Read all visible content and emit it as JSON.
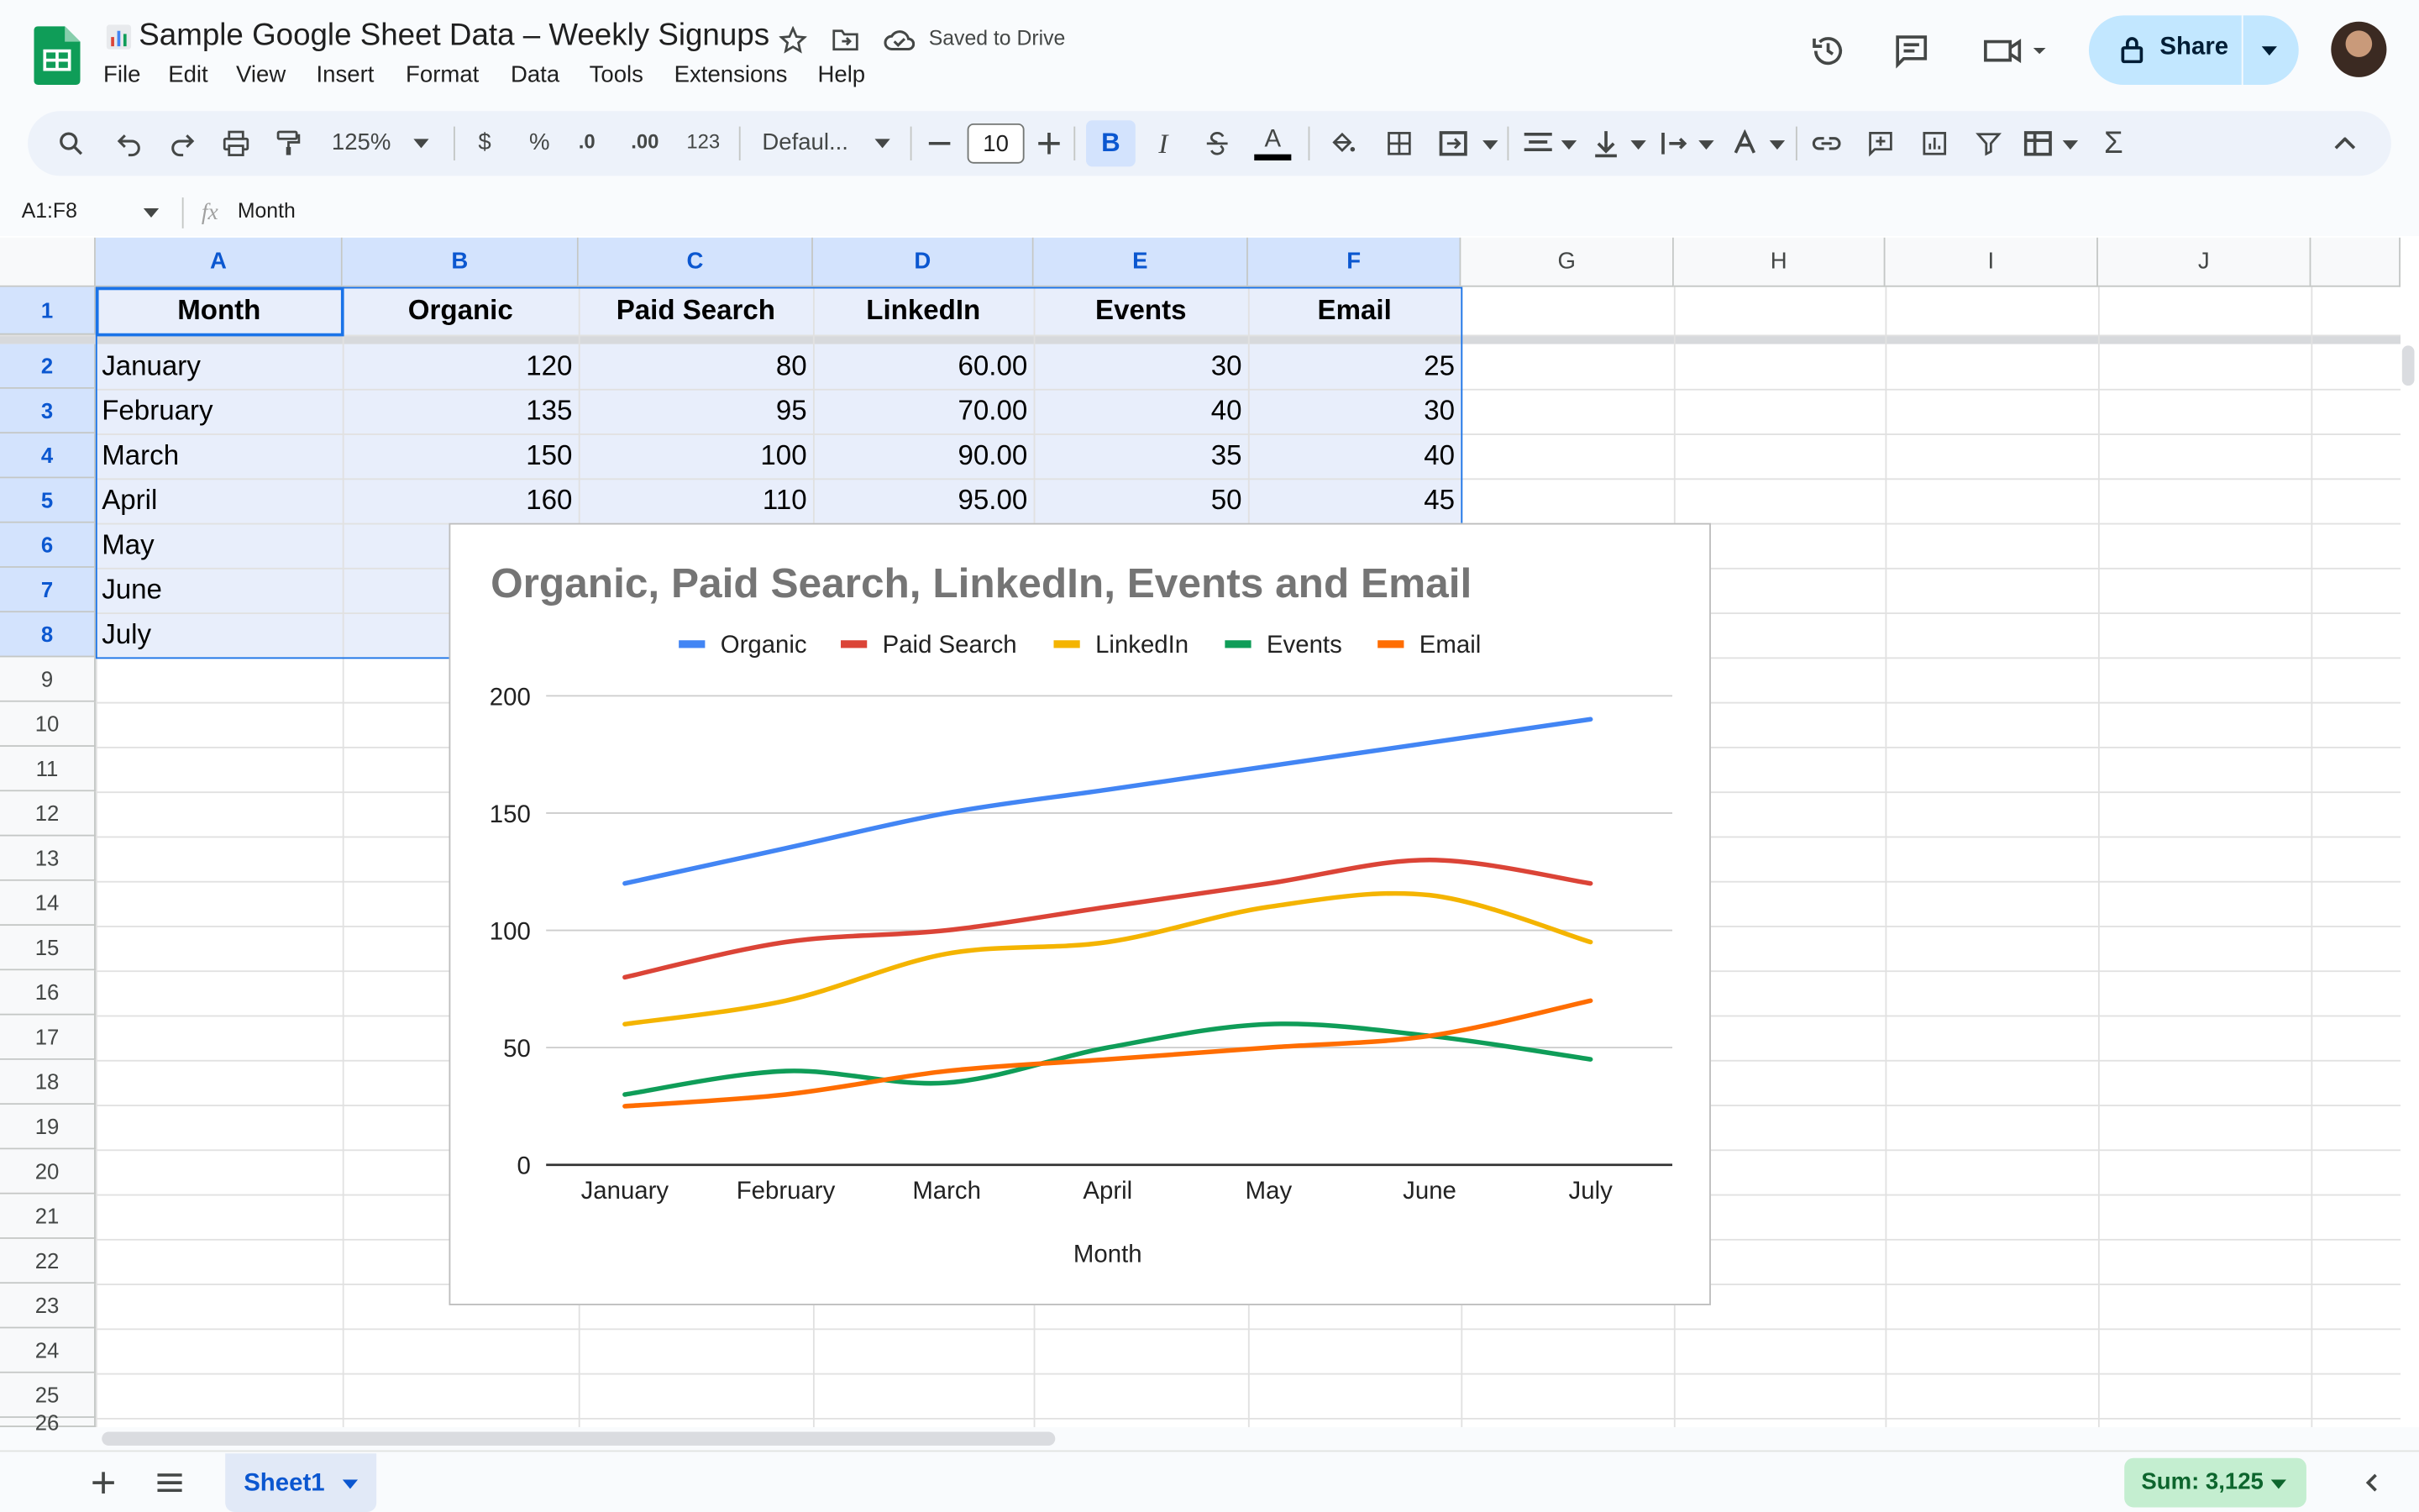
{
  "app": {
    "title": "Sample Google Sheet Data – Weekly Signups",
    "saved_status": "Saved to Drive",
    "menu": [
      "File",
      "Edit",
      "View",
      "Insert",
      "Format",
      "Data",
      "Tools",
      "Extensions",
      "Help"
    ],
    "share_label": "Share"
  },
  "toolbar": {
    "zoom": "125%",
    "currency": "$",
    "percent": "%",
    "dec_decrease": ".0",
    "dec_increase": ".00",
    "number_format": "123",
    "font": "Defaul...",
    "font_size": "10",
    "icons": [
      "search-icon",
      "undo-icon",
      "redo-icon",
      "print-icon",
      "paint-format-icon",
      "bold-icon",
      "italic-icon",
      "strikethrough-icon",
      "text-color-icon",
      "fill-color-icon",
      "borders-icon",
      "merge-icon",
      "align-icon",
      "valign-icon",
      "wrap-icon",
      "rotate-icon",
      "link-icon",
      "comment-icon",
      "chart-icon",
      "filter-icon",
      "table-view-icon",
      "functions-icon"
    ]
  },
  "formula_bar": {
    "name_box": "A1:F8",
    "formula": "Month"
  },
  "sheet": {
    "columns": [
      "A",
      "B",
      "C",
      "D",
      "E",
      "F",
      "G",
      "H",
      "I",
      "J"
    ],
    "rows": [
      "1",
      "2",
      "3",
      "4",
      "5",
      "6",
      "7",
      "8",
      "9",
      "10",
      "11",
      "12",
      "13",
      "14",
      "15",
      "16",
      "17",
      "18",
      "19",
      "20",
      "21",
      "22",
      "23",
      "24",
      "25",
      "26"
    ],
    "headers": [
      "Month",
      "Organic",
      "Paid Search",
      "LinkedIn",
      "Events",
      "Email"
    ],
    "data": [
      [
        "January",
        "120",
        "80",
        "60.00",
        "30",
        "25"
      ],
      [
        "February",
        "135",
        "95",
        "70.00",
        "40",
        "30"
      ],
      [
        "March",
        "150",
        "100",
        "90.00",
        "35",
        "40"
      ],
      [
        "April",
        "160",
        "110",
        "95.00",
        "50",
        "45"
      ],
      [
        "May",
        "",
        "",
        "",
        "",
        ""
      ],
      [
        "June",
        "",
        "",
        "",
        "",
        ""
      ],
      [
        "July",
        "",
        "",
        "",
        "",
        ""
      ]
    ]
  },
  "chart_data": {
    "type": "line",
    "title": "Organic, Paid Search, LinkedIn, Events and Email",
    "xlabel": "Month",
    "ylabel": "",
    "categories": [
      "January",
      "February",
      "March",
      "April",
      "May",
      "June",
      "July"
    ],
    "ylim": [
      0,
      200
    ],
    "yticks": [
      "0",
      "50",
      "100",
      "150",
      "200"
    ],
    "grid": true,
    "legend_position": "top",
    "series": [
      {
        "name": "Organic",
        "color": "#4285f4",
        "values": [
          120,
          135,
          150,
          160,
          170,
          180,
          190
        ]
      },
      {
        "name": "Paid Search",
        "color": "#db4437",
        "values": [
          80,
          95,
          100,
          110,
          120,
          130,
          120
        ]
      },
      {
        "name": "LinkedIn",
        "color": "#f4b400",
        "values": [
          60,
          70,
          90,
          95,
          110,
          115,
          95
        ]
      },
      {
        "name": "Events",
        "color": "#0f9d58",
        "values": [
          30,
          40,
          35,
          50,
          60,
          55,
          45
        ]
      },
      {
        "name": "Email",
        "color": "#ff6d01",
        "values": [
          25,
          30,
          40,
          45,
          50,
          55,
          70
        ]
      }
    ]
  },
  "bottom": {
    "sheet_tab": "Sheet1",
    "sum": "Sum: 3,125"
  },
  "colors": {
    "accent": "#0b57d0",
    "selection": "#d3e3fd",
    "share_bg": "#c2e7ff",
    "sum_bg": "#c4eed0"
  }
}
